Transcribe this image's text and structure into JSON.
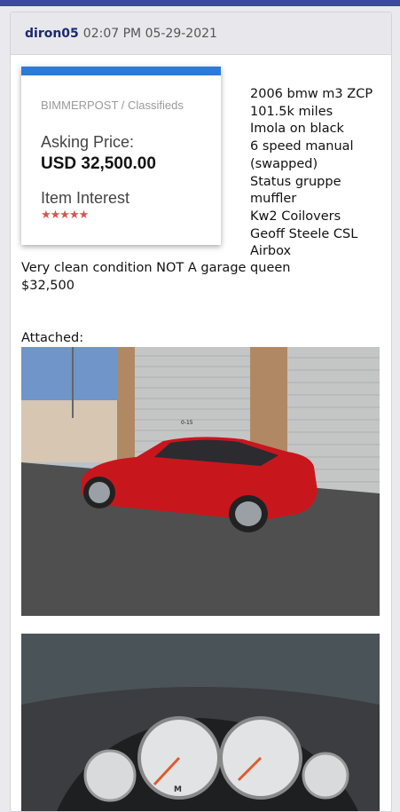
{
  "post": {
    "username": "diron05",
    "timestamp": "02:07 PM 05-29-2021"
  },
  "classified": {
    "site": "BIMMERPOST / Classifieds",
    "asking_label": "Asking Price:",
    "price": "USD 32,500.00",
    "interest_label": "Item Interest",
    "stars": "★★★★★"
  },
  "description": {
    "lines": [
      "2006 bmw m3 ZCP",
      "101.5k miles",
      "Imola on black",
      "6 speed manual",
      "(swapped)",
      "Status gruppe",
      "muffler",
      "Kw2 Coilovers",
      "Geoff Steele CSL",
      "Airbox"
    ],
    "condition": "Very clean condition NOT A garage queen",
    "price_text": "$32,500",
    "attached_label": "Attached:"
  },
  "photos": {
    "photo1_sign": "0-15",
    "photo2_gauge": "M"
  },
  "colors": {
    "header_bar": "#3b4a9e",
    "stripe": "#2d7bd8",
    "car": "#c8161d",
    "stars": "#d9534f"
  }
}
